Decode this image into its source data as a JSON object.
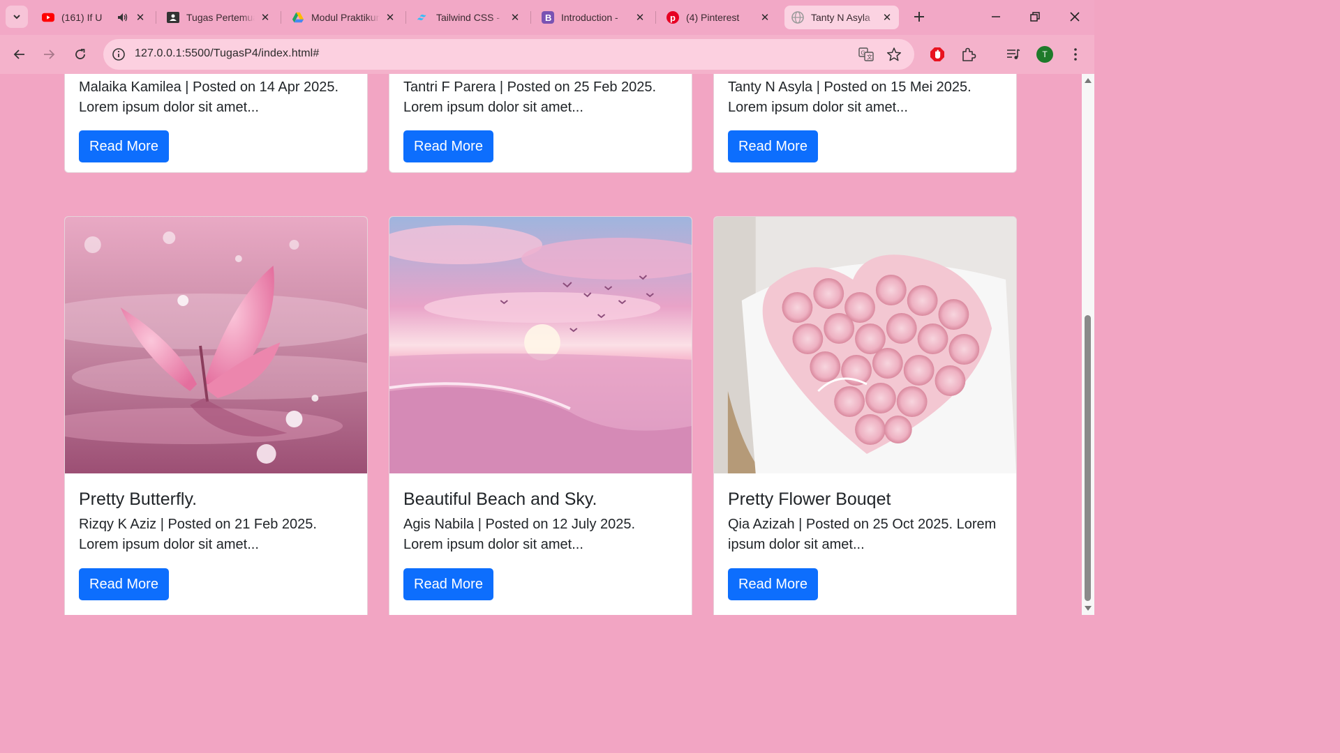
{
  "browser": {
    "tabs": [
      {
        "title": "(161) If U",
        "favicon": "youtube-icon",
        "color": "#ff0000",
        "audio": true
      },
      {
        "title": "Tugas Pertemuan",
        "favicon": "classroom-icon",
        "color": "#333333"
      },
      {
        "title": "Modul Praktikum",
        "favicon": "google-drive-icon",
        "color": "#1fa463"
      },
      {
        "title": "Tailwind CSS -",
        "favicon": "tailwind-icon",
        "color": "#38bdf8"
      },
      {
        "title": "Introduction -",
        "favicon": "bootstrap-icon",
        "color": "#7952b3"
      },
      {
        "title": "(4) Pinterest",
        "favicon": "pinterest-icon",
        "color": "#e60023"
      },
      {
        "title": "Tanty N Asyla",
        "favicon": "globe-icon",
        "color": "#9a9a9a",
        "active": true
      }
    ],
    "url": "127.0.0.1:5500/TugasP4/index.html#",
    "profile_initial": "T",
    "accent_color": "#f2a5c3"
  },
  "page": {
    "top_cards": [
      {
        "text": "Malaika Kamilea | Posted on 14 Apr 2025. Lorem ipsum dolor sit amet...",
        "button": "Read More"
      },
      {
        "text": "Tantri F Parera | Posted on 25 Feb 2025. Lorem ipsum dolor sit amet...",
        "button": "Read More"
      },
      {
        "text": "Tanty N Asyla | Posted on 15 Mei 2025. Lorem ipsum dolor sit amet...",
        "button": "Read More"
      }
    ],
    "bottom_cards": [
      {
        "title": "Pretty Butterfly.",
        "text": "Rizqy K Aziz | Posted on 21 Feb 2025. Lorem ipsum dolor sit amet...",
        "button": "Read More",
        "image": "pink-butterfly-on-water"
      },
      {
        "title": "Beautiful Beach and Sky.",
        "text": "Agis Nabila | Posted on 12 July 2025. Lorem ipsum dolor sit amet...",
        "button": "Read More",
        "image": "pink-beach-sunset"
      },
      {
        "title": "Pretty Flower Bouqet",
        "text": "Qia Azizah | Posted on 25 Oct 2025. Lorem ipsum dolor sit amet...",
        "button": "Read More",
        "image": "heart-rose-bouquet"
      }
    ],
    "button_color": "#0d6efd"
  }
}
